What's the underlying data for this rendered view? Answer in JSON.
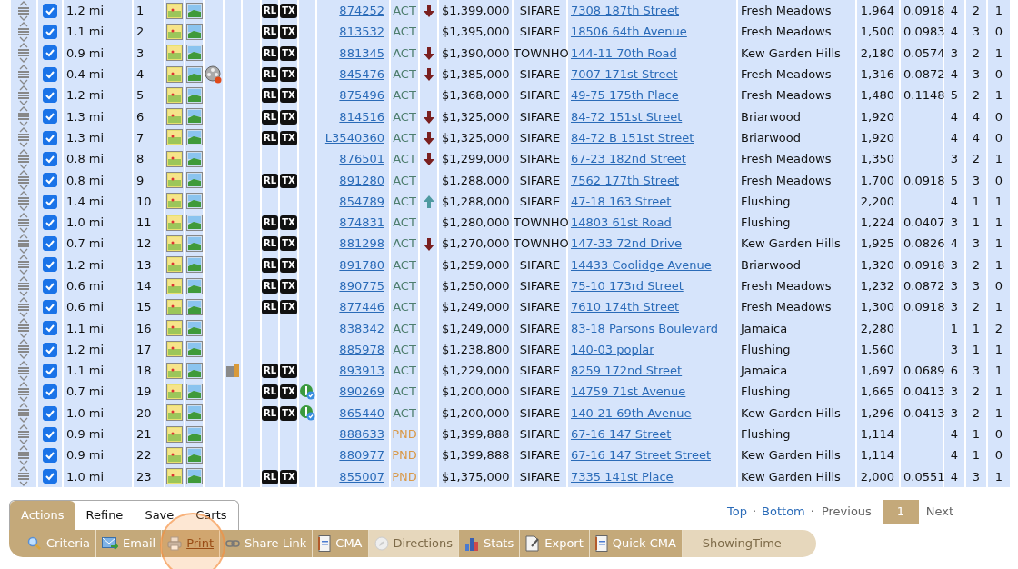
{
  "rows": [
    {
      "checked": true,
      "distance": "1.2 mi",
      "num": "1",
      "video": false,
      "door": false,
      "tags": [
        "RL",
        "TX"
      ],
      "badge": false,
      "mls": "874252",
      "status": {
        "label": "ACT",
        "color": "#4e7e6e"
      },
      "price_down": true,
      "price_up": false,
      "price": "$1,399,000",
      "type": "SIFARE",
      "address": "7308 187th Street",
      "area": "Fresh Meadows",
      "sqft": "1,964",
      "rate": "0.0918",
      "beds": "4",
      "baths": "2",
      "col_3": "1"
    },
    {
      "checked": true,
      "distance": "1.1 mi",
      "num": "2",
      "video": false,
      "door": false,
      "tags": [
        "RL",
        "TX"
      ],
      "badge": false,
      "mls": "813532",
      "status": {
        "label": "ACT",
        "color": "#4e7e6e"
      },
      "price_down": false,
      "price_up": false,
      "price": "$1,395,000",
      "type": "SIFARE",
      "address": "18506 64th Avenue",
      "area": "Fresh Meadows",
      "sqft": "1,500",
      "rate": "0.0983",
      "beds": "4",
      "baths": "3",
      "col_3": "0"
    },
    {
      "checked": true,
      "distance": "0.9 mi",
      "num": "3",
      "video": false,
      "door": false,
      "tags": [
        "RL",
        "TX"
      ],
      "badge": false,
      "mls": "881345",
      "status": {
        "label": "ACT",
        "color": "#4e7e6e"
      },
      "price_down": true,
      "price_up": false,
      "price": "$1,390,000",
      "type": "TOWNHO",
      "address": "144-11 70th Road",
      "area": "Kew Garden Hills",
      "sqft": "2,180",
      "rate": "0.0574",
      "beds": "3",
      "baths": "2",
      "col_3": "1"
    },
    {
      "checked": true,
      "distance": "0.4 mi",
      "num": "4",
      "video": true,
      "door": false,
      "tags": [
        "RL",
        "TX"
      ],
      "badge": false,
      "mls": "845476",
      "status": {
        "label": "ACT",
        "color": "#4e7e6e"
      },
      "price_down": true,
      "price_up": false,
      "price": "$1,385,000",
      "type": "SIFARE",
      "address": "7007 171st Street",
      "area": "Fresh Meadows",
      "sqft": "1,316",
      "rate": "0.0872",
      "beds": "4",
      "baths": "3",
      "col_3": "0"
    },
    {
      "checked": true,
      "distance": "1.2 mi",
      "num": "5",
      "video": false,
      "door": false,
      "tags": [
        "RL",
        "TX"
      ],
      "badge": false,
      "mls": "875496",
      "status": {
        "label": "ACT",
        "color": "#4e7e6e"
      },
      "price_down": false,
      "price_up": false,
      "price": "$1,368,000",
      "type": "SIFARE",
      "address": "49-75 175th Place",
      "area": "Fresh Meadows",
      "sqft": "1,480",
      "rate": "0.1148",
      "beds": "5",
      "baths": "2",
      "col_3": "1"
    },
    {
      "checked": true,
      "distance": "1.3 mi",
      "num": "6",
      "video": false,
      "door": false,
      "tags": [
        "RL",
        "TX"
      ],
      "badge": false,
      "mls": "814516",
      "status": {
        "label": "ACT",
        "color": "#4e7e6e"
      },
      "price_down": true,
      "price_up": false,
      "price": "$1,325,000",
      "type": "SIFARE",
      "address": "84-72 151st Street",
      "area": "Briarwood",
      "sqft": "1,920",
      "beds": "4",
      "baths": "4",
      "col_3": "0"
    },
    {
      "checked": true,
      "distance": "1.3 mi",
      "num": "7",
      "video": false,
      "door": false,
      "tags": [
        "RL",
        "TX"
      ],
      "badge": false,
      "mls": "L3540360",
      "status": {
        "label": "ACT",
        "color": "#4e7e6e"
      },
      "price_down": true,
      "price_up": false,
      "price": "$1,325,000",
      "type": "SIFARE",
      "address": "84-72 B 151st Street",
      "area": "Briarwood",
      "sqft": "1,920",
      "beds": "4",
      "baths": "4",
      "col_3": "0"
    },
    {
      "checked": true,
      "distance": "0.8 mi",
      "num": "8",
      "video": false,
      "door": false,
      "badge": false,
      "mls": "876501",
      "status": {
        "label": "ACT",
        "color": "#4e7e6e"
      },
      "price_down": true,
      "price_up": false,
      "price": "$1,299,000",
      "type": "SIFARE",
      "address": "67-23 182nd Street",
      "area": "Fresh Meadows",
      "sqft": "1,350",
      "beds": "3",
      "baths": "2",
      "col_3": "1"
    },
    {
      "checked": true,
      "distance": "0.8 mi",
      "num": "9",
      "video": false,
      "door": false,
      "tags": [
        "RL",
        "TX"
      ],
      "badge": false,
      "mls": "891280",
      "status": {
        "label": "ACT",
        "color": "#4e7e6e"
      },
      "price_down": false,
      "price_up": false,
      "price": "$1,288,000",
      "type": "SIFARE",
      "address": "7562 177th Street",
      "area": "Fresh Meadows",
      "sqft": "1,700",
      "rate": "0.0918",
      "beds": "5",
      "baths": "3",
      "col_3": "0"
    },
    {
      "checked": true,
      "distance": "1.4 mi",
      "num": "10",
      "video": false,
      "door": false,
      "badge": false,
      "mls": "854789",
      "status": {
        "label": "ACT",
        "color": "#4e7e6e"
      },
      "price_down": false,
      "price_up": true,
      "price": "$1,288,000",
      "type": "SIFARE",
      "address": "47-18 163 Street",
      "area": "Flushing",
      "sqft": "2,200",
      "beds": "4",
      "baths": "1",
      "col_3": "1"
    },
    {
      "checked": true,
      "distance": "1.0 mi",
      "num": "11",
      "video": false,
      "door": false,
      "tags": [
        "RL",
        "TX"
      ],
      "badge": false,
      "mls": "874831",
      "status": {
        "label": "ACT",
        "color": "#4e7e6e"
      },
      "price_down": false,
      "price_up": false,
      "price": "$1,280,000",
      "type": "TOWNHO",
      "address": "14803 61st Road",
      "area": "Flushing",
      "sqft": "1,224",
      "rate": "0.0407",
      "beds": "3",
      "baths": "1",
      "col_3": "1"
    },
    {
      "checked": true,
      "distance": "0.7 mi",
      "num": "12",
      "video": false,
      "door": false,
      "tags": [
        "RL",
        "TX"
      ],
      "badge": false,
      "mls": "881298",
      "status": {
        "label": "ACT",
        "color": "#4e7e6e"
      },
      "price_down": true,
      "price_up": false,
      "price": "$1,270,000",
      "type": "TOWNHO",
      "address": "147-33 72nd Drive",
      "area": "Kew Garden Hills",
      "sqft": "1,925",
      "rate": "0.0826",
      "beds": "4",
      "baths": "3",
      "col_3": "1"
    },
    {
      "checked": true,
      "distance": "1.2 mi",
      "num": "13",
      "video": false,
      "door": false,
      "tags": [
        "RL",
        "TX"
      ],
      "badge": false,
      "mls": "891780",
      "status": {
        "label": "ACT",
        "color": "#4e7e6e"
      },
      "price_down": false,
      "price_up": false,
      "price": "$1,259,000",
      "type": "SIFARE",
      "address": "14433 Coolidge Avenue",
      "area": "Briarwood",
      "sqft": "1,320",
      "rate": "0.0918",
      "beds": "3",
      "baths": "2",
      "col_3": "1"
    },
    {
      "checked": true,
      "distance": "0.6 mi",
      "num": "14",
      "video": false,
      "door": false,
      "tags": [
        "RL",
        "TX"
      ],
      "badge": false,
      "mls": "890775",
      "status": {
        "label": "ACT",
        "color": "#4e7e6e"
      },
      "price_down": false,
      "price_up": false,
      "price": "$1,250,000",
      "type": "SIFARE",
      "address": "75-10 173rd Street",
      "area": "Fresh Meadows",
      "sqft": "1,232",
      "rate": "0.0872",
      "beds": "3",
      "baths": "3",
      "col_3": "0"
    },
    {
      "checked": true,
      "distance": "0.6 mi",
      "num": "15",
      "video": false,
      "door": false,
      "tags": [
        "RL",
        "TX"
      ],
      "badge": false,
      "mls": "877446",
      "status": {
        "label": "ACT",
        "color": "#4e7e6e"
      },
      "price_down": false,
      "price_up": false,
      "price": "$1,249,000",
      "type": "SIFARE",
      "address": "7610 174th Street",
      "area": "Fresh Meadows",
      "sqft": "1,300",
      "rate": "0.0918",
      "beds": "3",
      "baths": "2",
      "col_3": "1"
    },
    {
      "checked": true,
      "distance": "1.1 mi",
      "num": "16",
      "video": false,
      "door": false,
      "badge": false,
      "mls": "838342",
      "status": {
        "label": "ACT",
        "color": "#4e7e6e"
      },
      "price_down": false,
      "price_up": false,
      "price": "$1,249,000",
      "type": "SIFARE",
      "address": "83-18 Parsons Boulevard",
      "area": "Jamaica",
      "sqft": "2,280",
      "beds": "1",
      "baths": "1",
      "col_3": "2"
    },
    {
      "checked": true,
      "distance": "1.2 mi",
      "num": "17",
      "video": false,
      "door": false,
      "badge": false,
      "mls": "885978",
      "status": {
        "label": "ACT",
        "color": "#4e7e6e"
      },
      "price_down": false,
      "price_up": false,
      "price": "$1,238,800",
      "type": "SIFARE",
      "address": "140-03 poplar",
      "area": "Flushing",
      "sqft": "1,560",
      "beds": "3",
      "baths": "1",
      "col_3": "1"
    },
    {
      "checked": true,
      "distance": "1.1 mi",
      "num": "18",
      "video": false,
      "door": true,
      "tags": [
        "RL",
        "TX"
      ],
      "badge": false,
      "mls": "893913",
      "status": {
        "label": "ACT",
        "color": "#4e7e6e"
      },
      "price_down": false,
      "price_up": false,
      "price": "$1,229,000",
      "type": "SIFARE",
      "address": "8259 172nd Street",
      "area": "Jamaica",
      "sqft": "1,697",
      "rate": "0.0689",
      "beds": "6",
      "baths": "3",
      "col_3": "1"
    },
    {
      "checked": true,
      "distance": "0.7 mi",
      "num": "19",
      "video": false,
      "door": false,
      "tags": [
        "RL",
        "TX"
      ],
      "badge": true,
      "mls": "890269",
      "status": {
        "label": "ACT",
        "color": "#4e7e6e"
      },
      "price_down": false,
      "price_up": false,
      "price": "$1,200,000",
      "type": "SIFARE",
      "address": "14759 71st Avenue",
      "area": "Flushing",
      "sqft": "1,665",
      "rate": "0.0413",
      "beds": "3",
      "baths": "2",
      "col_3": "1"
    },
    {
      "checked": true,
      "distance": "1.0 mi",
      "num": "20",
      "video": false,
      "door": false,
      "tags": [
        "RL",
        "TX"
      ],
      "badge": true,
      "mls": "865440",
      "status": {
        "label": "ACT",
        "color": "#4e7e6e"
      },
      "price_down": false,
      "price_up": false,
      "price": "$1,200,000",
      "type": "SIFARE",
      "address": "140-21 69th Avenue",
      "area": "Kew Garden Hills",
      "sqft": "1,296",
      "rate": "0.0413",
      "beds": "3",
      "baths": "2",
      "col_3": "1"
    },
    {
      "checked": true,
      "distance": "0.9 mi",
      "num": "21",
      "video": false,
      "door": false,
      "badge": false,
      "mls": "888633",
      "status": {
        "label": "PND",
        "color": "#d99a4a"
      },
      "price_down": false,
      "price_up": false,
      "price": "$1,399,888",
      "type": "SIFARE",
      "address": "67-16 147 Street",
      "area": "Flushing",
      "sqft": "1,114",
      "beds": "4",
      "baths": "1",
      "col_3": "0"
    },
    {
      "checked": true,
      "distance": "0.9 mi",
      "num": "22",
      "video": false,
      "door": false,
      "badge": false,
      "mls": "880977",
      "status": {
        "label": "PND",
        "color": "#d99a4a"
      },
      "price_down": false,
      "price_up": false,
      "price": "$1,399,888",
      "type": "SIFARE",
      "address": "67-16 147 Street Street",
      "area": "Kew Garden Hills",
      "sqft": "1,114",
      "beds": "4",
      "baths": "1",
      "col_3": "0"
    },
    {
      "checked": true,
      "distance": "1.0 mi",
      "num": "23",
      "video": false,
      "door": false,
      "tags": [
        "RL",
        "TX"
      ],
      "badge": false,
      "mls": "855007",
      "status": {
        "label": "PND",
        "color": "#d99a4a"
      },
      "price_down": false,
      "price_up": false,
      "price": "$1,375,000",
      "type": "SIFARE",
      "address": "7335 141st Place",
      "area": "Kew Garden Hills",
      "sqft": "2,000",
      "rate": "0.0551",
      "beds": "4",
      "baths": "3",
      "col_3": "1"
    }
  ],
  "tabs": [
    {
      "label": "Actions",
      "selected": true
    },
    {
      "label": "Refine",
      "selected": false
    },
    {
      "label": "Save",
      "selected": false
    },
    {
      "label": "Carts",
      "selected": false
    }
  ],
  "actions": [
    {
      "label": "Criteria",
      "disabled": false,
      "highlighted": false
    },
    {
      "label": "Email",
      "disabled": false,
      "highlighted": false
    },
    {
      "label": "Print",
      "disabled": false,
      "highlighted": true
    },
    {
      "label": "Share Link",
      "disabled": false,
      "highlighted": false
    },
    {
      "label": "CMA",
      "disabled": false,
      "highlighted": false
    },
    {
      "label": "Directions",
      "disabled": true,
      "highlighted": false
    },
    {
      "label": "Stats",
      "disabled": false,
      "highlighted": false
    },
    {
      "label": "Export",
      "disabled": false,
      "highlighted": false
    },
    {
      "label": "Quick CMA",
      "disabled": false,
      "highlighted": false
    },
    {
      "label": "ShowingTime",
      "disabled": true,
      "highlighted": false
    }
  ],
  "pagination": {
    "links": [
      "Top",
      "Bottom"
    ],
    "separator": "·",
    "previous": "Previous",
    "pages": [
      {
        "label": "1",
        "selected": true
      }
    ],
    "next": "Next"
  }
}
